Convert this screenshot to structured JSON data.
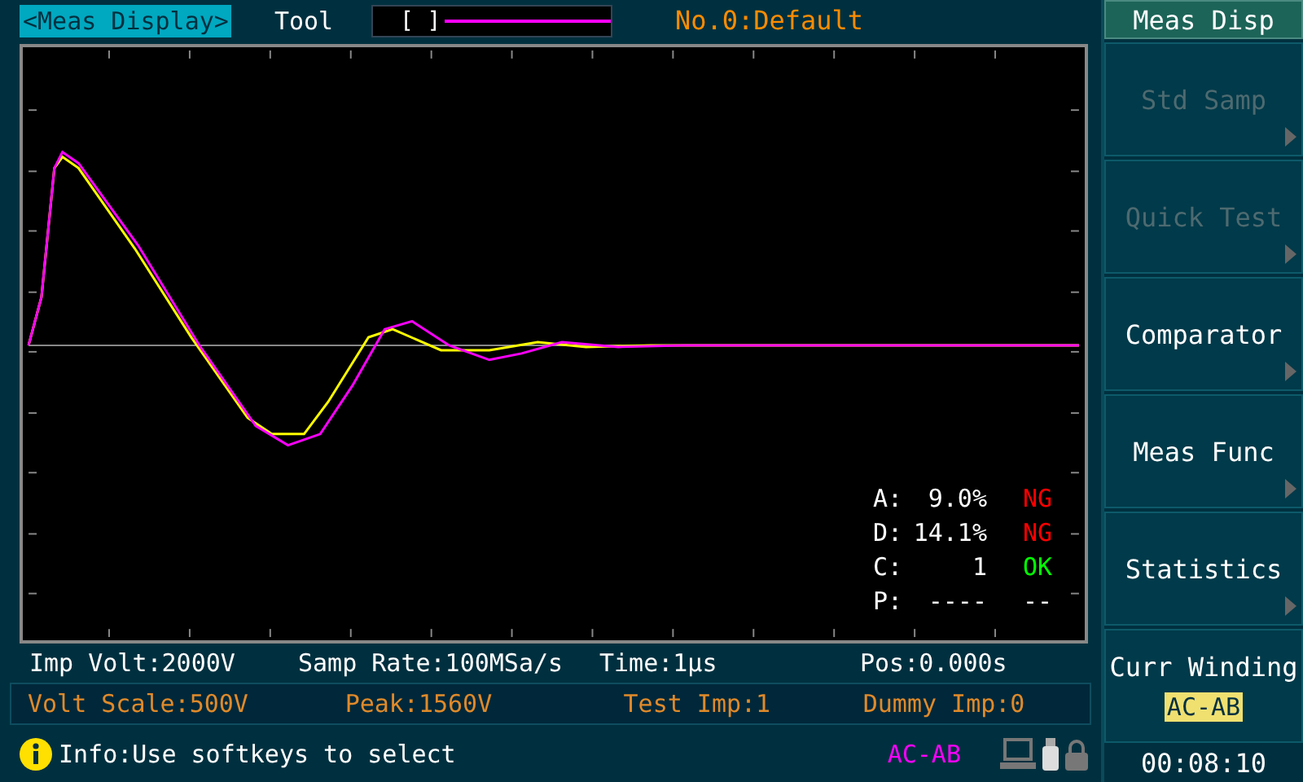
{
  "top_bar": {
    "menu_title": "<Meas Display>",
    "tool_label": "Tool",
    "tool_cursor": "[ ]",
    "preset": "No.0:Default"
  },
  "results": [
    {
      "label": "A:",
      "value": "9.0%",
      "verdict": "NG",
      "color": "#ff0000"
    },
    {
      "label": "D:",
      "value": "14.1%",
      "verdict": "NG",
      "color": "#ff0000"
    },
    {
      "label": "C:",
      "value": "1",
      "verdict": "OK",
      "color": "#00ff00"
    },
    {
      "label": "P:",
      "value": "----",
      "verdict": "--",
      "color": "#ffffff"
    }
  ],
  "settings_row": [
    "Imp Volt:2000V",
    "Samp Rate:100MSa/s",
    "Time:1μs",
    "Pos:0.000s"
  ],
  "scale_row": [
    "Volt Scale:500V",
    "Peak:1560V",
    "Test Imp:1",
    "Dummy Imp:0"
  ],
  "status_bar": {
    "info": "Info:Use softkeys to select",
    "mode": "AC-AB"
  },
  "softkeys": {
    "title": "Meas Disp",
    "items": [
      {
        "label": "Std Samp",
        "disabled": true
      },
      {
        "label": "Quick Test",
        "disabled": true
      },
      {
        "label": "Comparator",
        "disabled": false
      },
      {
        "label": "Meas Func",
        "disabled": false
      },
      {
        "label": "Statistics",
        "disabled": false
      }
    ],
    "winding": {
      "label": "Curr Winding",
      "value": "AC-AB"
    },
    "time": "00:08:10"
  }
}
